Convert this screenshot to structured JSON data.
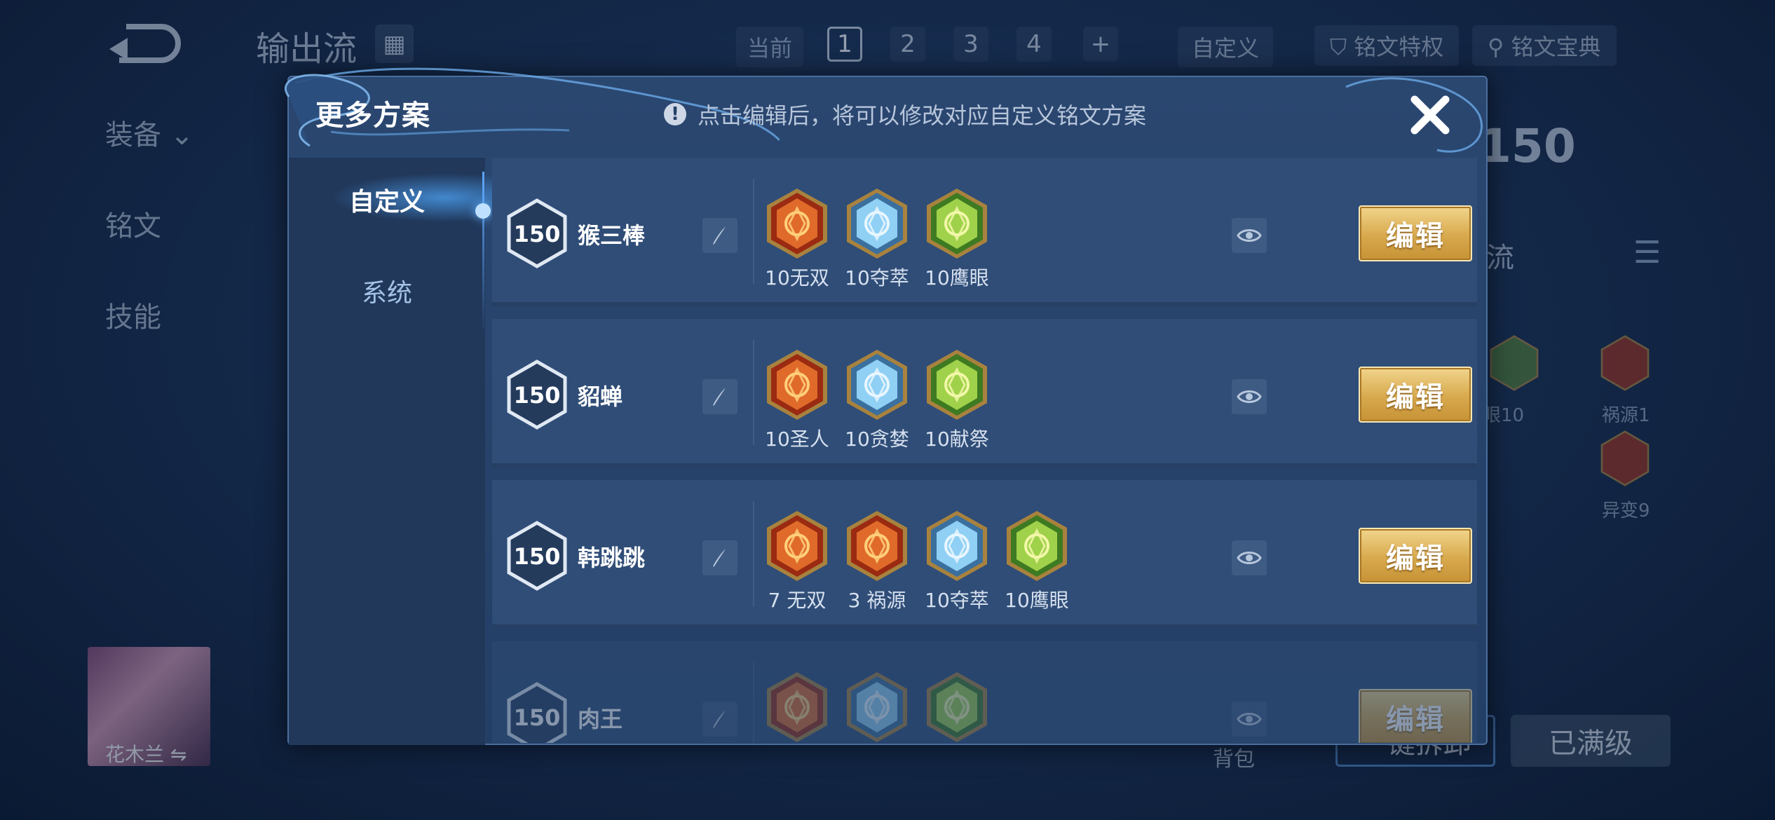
{
  "background": {
    "title": "输出流",
    "current_label": "当前",
    "pages": [
      "1",
      "2",
      "3",
      "4",
      "+"
    ],
    "custom_label": "自定义",
    "privilege_label": "铭文特权",
    "codex_label": "铭文宝典",
    "left_nav": [
      "装备",
      "铭文",
      "技能"
    ],
    "level_badge": "150",
    "plan_name": "出流",
    "gem_labels": [
      "眼10",
      "祸源1",
      "异变9"
    ],
    "button_left": "一键拆卸",
    "button_right": "已满级",
    "hero_name": "花木兰",
    "bag_label": "背包"
  },
  "modal": {
    "title": "更多方案",
    "tip": "点击编辑后，将可以修改对应自定义铭文方案",
    "tabs": [
      "自定义",
      "系统"
    ],
    "edit_label": "编辑",
    "rows": [
      {
        "level": "150",
        "name": "猴三棒",
        "gems": [
          {
            "label": "10无双",
            "icon": "red-rune-icon"
          },
          {
            "label": "10夺萃",
            "icon": "blue-rune-icon"
          },
          {
            "label": "10鹰眼",
            "icon": "green-rune-icon"
          }
        ]
      },
      {
        "level": "150",
        "name": "貂蝉",
        "gems": [
          {
            "label": "10圣人",
            "icon": "red-rune-icon"
          },
          {
            "label": "10贪婪",
            "icon": "blue-rune-icon"
          },
          {
            "label": "10献祭",
            "icon": "green-rune-icon"
          }
        ]
      },
      {
        "level": "150",
        "name": "韩跳跳",
        "gems": [
          {
            "label": "7 无双",
            "icon": "red-rune-icon"
          },
          {
            "label": "3 祸源",
            "icon": "red-rune-icon"
          },
          {
            "label": "10夺萃",
            "icon": "blue-rune-icon"
          },
          {
            "label": "10鹰眼",
            "icon": "green-rune-icon"
          }
        ]
      },
      {
        "level": "150",
        "name": "肉王",
        "gems": [
          {
            "label": "",
            "icon": "red-rune-icon"
          },
          {
            "label": "",
            "icon": "blue-rune-icon"
          },
          {
            "label": "",
            "icon": "green-rune-icon"
          }
        ]
      }
    ]
  },
  "colors": {
    "accent_gold": "#d8a94d",
    "panel_blue": "#2f4d77",
    "rune_red": "#c8431f",
    "rune_blue": "#4f8fc2",
    "rune_green": "#7fb93c"
  }
}
